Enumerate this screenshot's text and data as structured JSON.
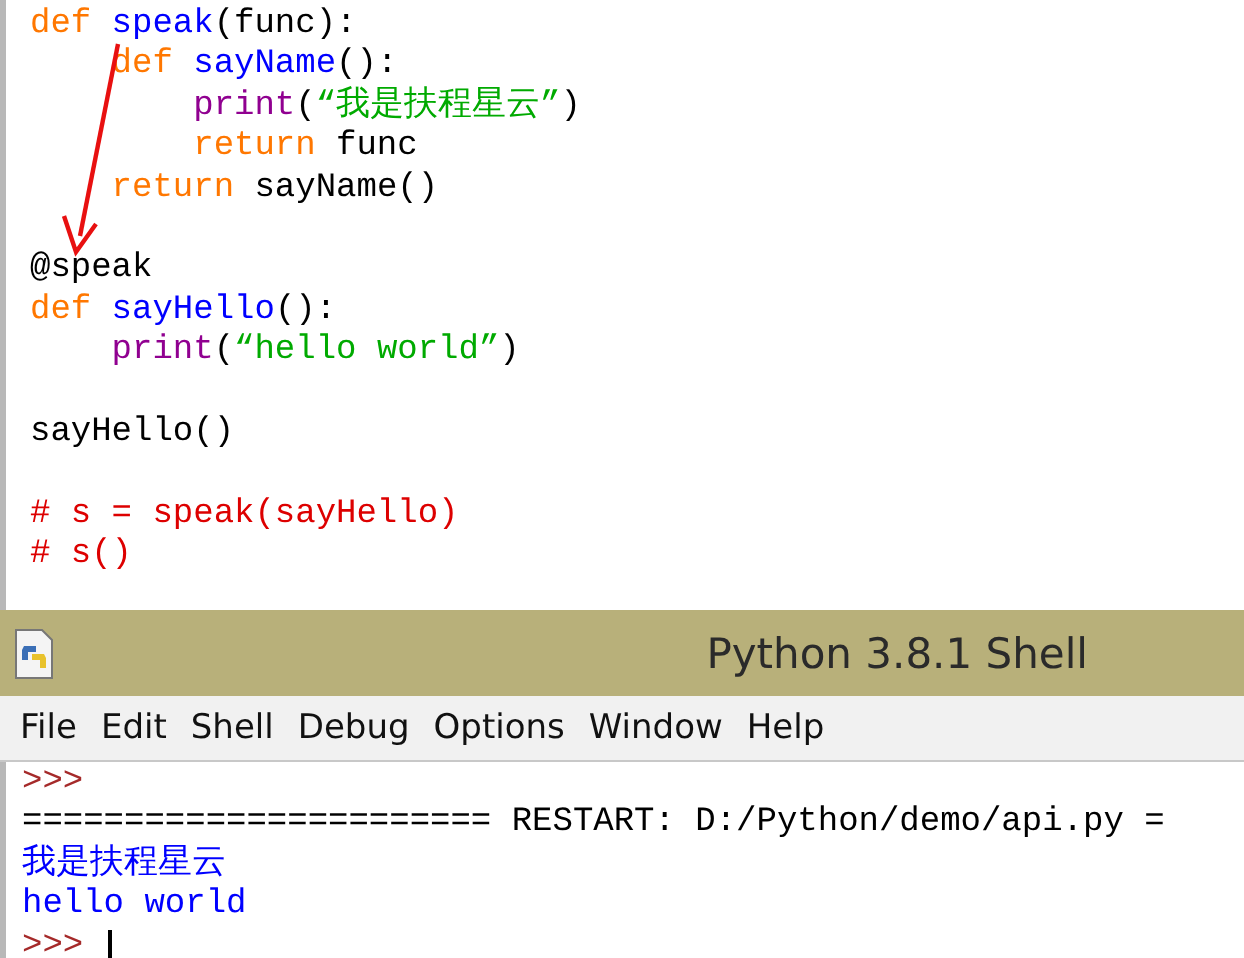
{
  "editor": {
    "lines": [
      {
        "kind": "code",
        "tokens": [
          {
            "text": "def",
            "kind": "keyword"
          },
          {
            "text": " speak",
            "kind": "defname"
          },
          {
            "text": "(func):",
            "kind": "plain"
          }
        ]
      },
      {
        "kind": "code",
        "tokens": [
          {
            "text": "    def",
            "kind": "keyword"
          },
          {
            "text": " sayName",
            "kind": "defname"
          },
          {
            "text": "():",
            "kind": "plain"
          }
        ]
      },
      {
        "kind": "code",
        "tokens": [
          {
            "text": "        print",
            "kind": "builtin"
          },
          {
            "text": "(",
            "kind": "plain"
          },
          {
            "text": "“我是扶程星云”",
            "kind": "string"
          },
          {
            "text": ")",
            "kind": "plain"
          }
        ]
      },
      {
        "kind": "code",
        "tokens": [
          {
            "text": "        return",
            "kind": "keyword"
          },
          {
            "text": " func",
            "kind": "plain"
          }
        ]
      },
      {
        "kind": "code",
        "tokens": [
          {
            "text": "    return",
            "kind": "keyword"
          },
          {
            "text": " sayName()",
            "kind": "plain"
          }
        ]
      },
      {
        "kind": "blank"
      },
      {
        "kind": "code",
        "tokens": [
          {
            "text": "@speak",
            "kind": "plain"
          }
        ]
      },
      {
        "kind": "code",
        "tokens": [
          {
            "text": "def",
            "kind": "keyword"
          },
          {
            "text": " sayHello",
            "kind": "defname"
          },
          {
            "text": "():",
            "kind": "plain"
          }
        ]
      },
      {
        "kind": "code",
        "tokens": [
          {
            "text": "    print",
            "kind": "builtin"
          },
          {
            "text": "(",
            "kind": "plain"
          },
          {
            "text": "“hello world”",
            "kind": "string"
          },
          {
            "text": ")",
            "kind": "plain"
          }
        ]
      },
      {
        "kind": "blank"
      },
      {
        "kind": "code",
        "tokens": [
          {
            "text": "sayHello()",
            "kind": "plain"
          }
        ]
      },
      {
        "kind": "blank"
      },
      {
        "kind": "code",
        "tokens": [
          {
            "text": "# s = speak(sayHello)",
            "kind": "comment"
          }
        ]
      },
      {
        "kind": "code",
        "tokens": [
          {
            "text": "# s()",
            "kind": "comment"
          }
        ]
      }
    ]
  },
  "shell": {
    "title": "Python 3.8.1 Shell",
    "menu": [
      "File",
      "Edit",
      "Shell",
      "Debug",
      "Options",
      "Window",
      "Help"
    ],
    "lines": [
      {
        "text": ">>>",
        "kind": "prompt",
        "cursor": false
      },
      {
        "text": "======================= RESTART: D:/Python/demo/api.py =",
        "kind": "restart",
        "cursor": false
      },
      {
        "text": "我是扶程星云",
        "kind": "output",
        "cursor": false
      },
      {
        "text": "hello world",
        "kind": "output",
        "cursor": false
      },
      {
        "text": ">>>",
        "kind": "prompt",
        "cursor": true
      }
    ]
  }
}
